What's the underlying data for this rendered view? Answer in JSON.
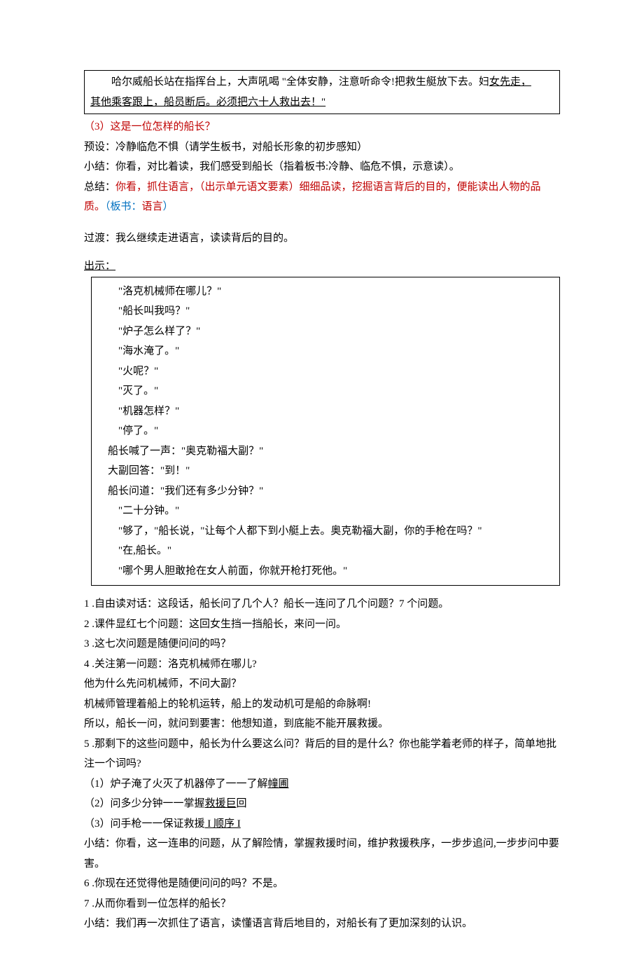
{
  "box1": {
    "p1_prefix": "哈尔威船长站在指挥台上，大声吼喝 \"全体安静，注意听命令!把救生艇放下去。妇",
    "p1_u1": "女先走，",
    "p2_u": "其他乘客跟上，船员断后。必须把六十人救出去！\""
  },
  "q3": "（3）这是一位怎样的船长？",
  "preset": "预设：冷静临危不惧（请学生板书，对船长形象的初步感知）",
  "sum1": "小结：你看，对比着读，我们感受到船长（指着板书:冷静、临危不惧，示意读）。",
  "conclusion_p1": "总结：",
  "conclusion_p2": "你看，抓住语言，（出示单元语文要素）细细品读，挖掘语言背后的目的，便能读出人物的品质。",
  "conclusion_p3": "（板书：",
  "conclusion_p4": "语言",
  "conclusion_p5": "）",
  "trans": "过渡：我么继续走进语言，读读背后的目的。",
  "show": "出示：",
  "box2": {
    "l1": "\"洛克机械师在哪儿？\"",
    "l2": "\"船长叫我吗？\"",
    "l3": "\"炉子怎么样了？\"",
    "l4": "\"海水淹了。\"",
    "l5": "\"火呢？\"",
    "l6": "\"灭了。\"",
    "l7": "\"机器怎样？\"",
    "l8": "\"停了。\"",
    "l9": "船长喊了一声：\"奥克勒福大副？\"",
    "l10": "大副回答：\"到！\"",
    "l11": "船长问道：\"我们还有多少分钟？\"",
    "l12": "\"二十分钟。\"",
    "l13": "\"够了，\"船长说，\"让每个人都下到小艇上去。奥克勒福大副，你的手枪在吗？\"",
    "l14": "\"在,船长。\"",
    "l15": "\"哪个男人胆敢抢在女人前面，你就开枪打死他。\""
  },
  "n1": "1 .自由读对话：这段话，船长问了几个人？船长一连问了几个问题？7 个问题。",
  "n2": "2 .课件显红七个问题：这回女生挡一挡船长，来问一问。",
  "n3": "3 .这七次问题是随便问问的吗？",
  "n4": "4 .关注第一问题：洛克机械师在哪儿?",
  "n4a": "他为什么先问机械师，不问大副？",
  "n4b": "机械师管理着船上的轮机运转，船上的发动机可是船的命脉啊!",
  "n4c": "所以，船长一问，就问到要害：他想知道，到底能不能开展救援。",
  "n5": "5 .那剩下的这些问题中，船长为什么要这么问？背后的目的是什么？你也能学着老师的样子，简单地批注一个词吗?",
  "n5_1a": "（1）炉子淹了火灭了机器停了一一了解",
  "n5_1b": "幢圃",
  "n5_2a": "（2）问多少分钟一一掌握",
  "n5_2b": "救援巨",
  "n5_2c": "回",
  "n5_3a": "（3）问手枪一一保证救援",
  "n5_3b": " I 顺序 I",
  "sum2": "小结：你看，这一连串的问题，从了解险情，掌握救援时间，维护救援秩序，一步步追问,一步步问中要害。",
  "n6": "6 .你现在还觉得他是随便问问的吗？不是。",
  "n7": "7 .从而你看到一位怎样的船长？",
  "sum3": "小结：我们再一次抓住了语言，读懂语言背后地目的，对船长有了更加深刻的认识。"
}
